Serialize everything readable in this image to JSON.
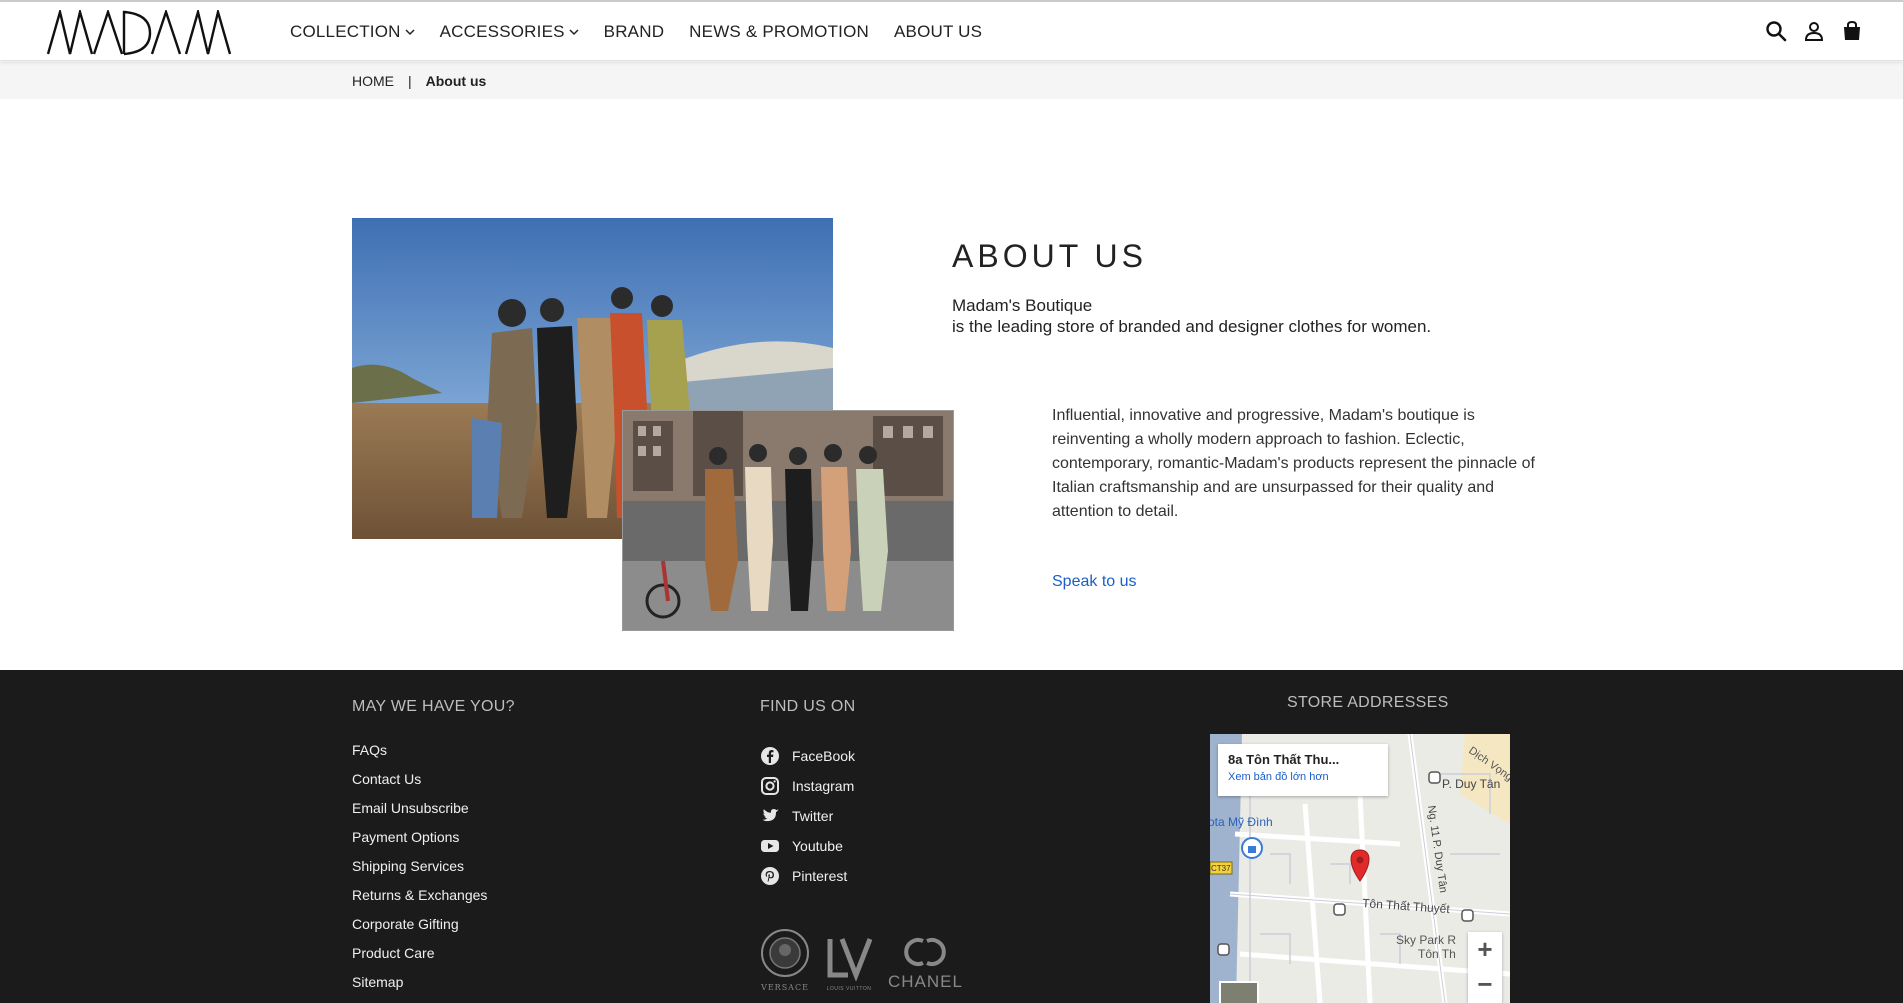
{
  "header": {
    "logo_text": "MADAM",
    "nav": [
      {
        "label": "COLLECTION",
        "has_dropdown": true
      },
      {
        "label": "ACCESSORIES",
        "has_dropdown": true
      },
      {
        "label": "BRAND",
        "has_dropdown": false
      },
      {
        "label": "NEWS & PROMOTION",
        "has_dropdown": false
      },
      {
        "label": "ABOUT US",
        "has_dropdown": false
      }
    ],
    "icons": [
      "search-icon",
      "user-icon",
      "shopping-bag-icon"
    ]
  },
  "breadcrumb": {
    "home": "HOME",
    "separator": "|",
    "current": "About us"
  },
  "about": {
    "title": "ABOUT US",
    "brand_line": "Madam's Boutique",
    "tagline": "is the leading store of branded and designer clothes for women.",
    "description": "Influential, innovative and progressive, Madam's boutique is reinventing a wholly modern approach to fashion. Eclectic, contemporary, romantic-Madam's products represent the pinnacle of Italian craftsmanship and are unsurpassed for their quality and attention to detail.",
    "cta": "Speak to us"
  },
  "footer": {
    "col1_title": "MAY WE HAVE YOU?",
    "links": [
      "FAQs",
      "Contact Us",
      "Email Unsubscribe",
      "Payment Options",
      "Shipping Services",
      "Returns & Exchanges",
      "Corporate Gifting",
      "Product Care",
      "Sitemap"
    ],
    "col2_title": "FIND US ON",
    "social": [
      {
        "label": "FaceBook",
        "icon": "facebook-icon"
      },
      {
        "label": "Instagram",
        "icon": "instagram-icon"
      },
      {
        "label": "Twitter",
        "icon": "twitter-icon"
      },
      {
        "label": "Youtube",
        "icon": "youtube-icon"
      },
      {
        "label": "Pinterest",
        "icon": "pinterest-icon"
      }
    ],
    "brands": [
      "VERSACE",
      "LOUIS VUITTON",
      "CHANEL"
    ],
    "col3_title": "STORE ADDRESSES",
    "map": {
      "place_title": "8a Tôn Thất Thu...",
      "place_link": "Xem bản đồ lớn hơn",
      "labels": [
        "P. Duy Tân",
        "Ng. 11 P. Duy Tân",
        "Tôn Thất Thuyết",
        "ota Mỹ Đình",
        "Sky Park R",
        "Tôn Th",
        "CT37",
        "Dịch Vọng"
      ],
      "zoom_in": "+",
      "zoom_out": "−"
    }
  },
  "colors": {
    "accent": "#1a5fc9",
    "footer_bg": "#1b1b1b",
    "crumb_bg": "#f5f5f5"
  }
}
